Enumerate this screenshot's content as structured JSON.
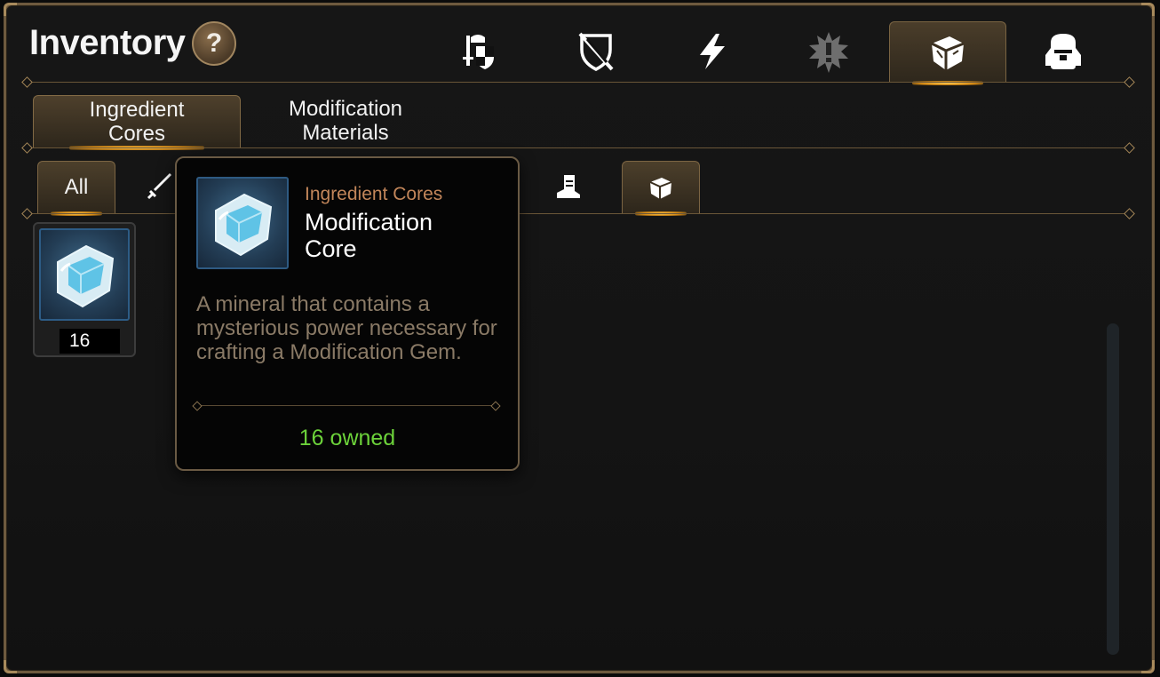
{
  "header": {
    "title": "Inventory",
    "help_label": "?"
  },
  "top_categories": [
    {
      "icon": "knight-shield-icon",
      "active": false
    },
    {
      "icon": "crossed-sword-shield-icon",
      "active": false
    },
    {
      "icon": "lightning-icon",
      "active": false
    },
    {
      "icon": "explosion-icon",
      "active": false
    },
    {
      "icon": "crystal-cube-icon",
      "active": true
    },
    {
      "icon": "backpack-icon",
      "active": false
    }
  ],
  "subtabs": [
    {
      "label_line1": "Ingredient",
      "label_line2": "Cores",
      "active": true
    },
    {
      "label_line1": "Modification",
      "label_line2": "Materials",
      "active": false
    }
  ],
  "filters": [
    {
      "label": "All",
      "active": true
    },
    {
      "icon": "sword-icon",
      "active": false
    },
    {
      "icon": "boot-icon",
      "active": false
    },
    {
      "icon": "core-cube-icon",
      "active": true
    }
  ],
  "items": [
    {
      "name": "Modification Core",
      "quantity": "16"
    }
  ],
  "tooltip": {
    "category": "Ingredient Cores",
    "name": "Modification Core",
    "description": "A mineral that contains a mysterious power necessary for crafting a Modification Gem.",
    "owned_text": "16 owned"
  },
  "colors": {
    "gold_border": "#6e5a3e",
    "category_text": "#c2865a",
    "description_text": "#8a7a66",
    "owned_text": "#6cd23a",
    "glow": "#ffcf5a"
  }
}
